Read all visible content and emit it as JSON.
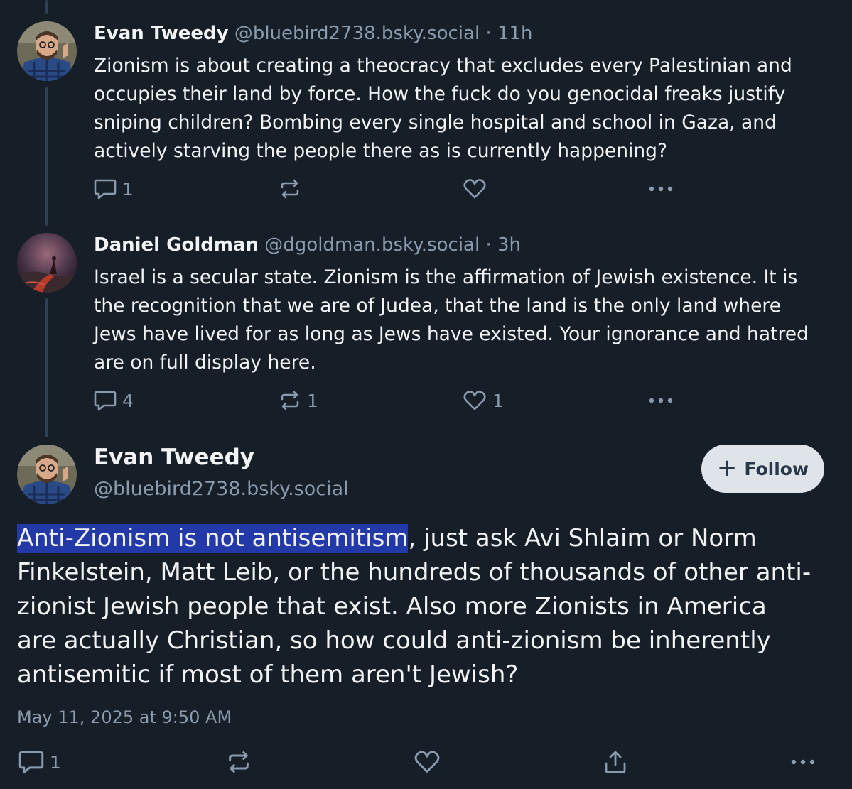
{
  "replies": [
    {
      "name": "Evan Tweedy",
      "handle": "@bluebird2738.bsky.social",
      "time": "· 11h",
      "text": "Zionism is about creating a theocracy that excludes every Palestinian and occupies their land by force. How the fuck do you genocidal freaks justify sniping children? Bombing every single hospital and school in Gaza, and actively starving the people there as is currently happening?",
      "reply_count": "1",
      "repost_count": "",
      "like_count": ""
    },
    {
      "name": "Daniel Goldman",
      "handle": "@dgoldman.bsky.social",
      "time": "· 3h",
      "text": "Israel is a secular state. Zionism is the affirmation of Jewish existence. It is the recognition that we are of Judea, that the land is the only land where Jews have lived for as long as Jews have existed. Your ignorance and hatred are on full display here.",
      "reply_count": "4",
      "repost_count": "1",
      "like_count": "1"
    }
  ],
  "main_post": {
    "name": "Evan Tweedy",
    "handle": "@bluebird2738.bsky.social",
    "follow_label": "Follow",
    "text_highlighted": "Anti-Zionism is not antisemitism",
    "text_rest": ", just ask Avi Shlaim or Norm Finkelstein, Matt Leib, or the hundreds of thousands of other anti-zionist Jewish people that exist. Also more Zionists in America are actually Christian, so how could anti-zionism be inherently antisemitic if most of them aren't Jewish?",
    "timestamp": "May 11, 2025 at 9:50 AM",
    "reply_count": "1"
  },
  "icons": {
    "reply": "speech-bubble-icon",
    "repost": "repost-arrows-icon",
    "like": "heart-icon",
    "more": "ellipsis-icon",
    "share": "share-upload-icon",
    "follow": "plus-icon"
  },
  "colors": {
    "background": "#161e27",
    "text": "#f1f3f5",
    "muted": "#8a9bad",
    "highlight": "#2439a8",
    "follow_bg": "#dfe4ea"
  }
}
